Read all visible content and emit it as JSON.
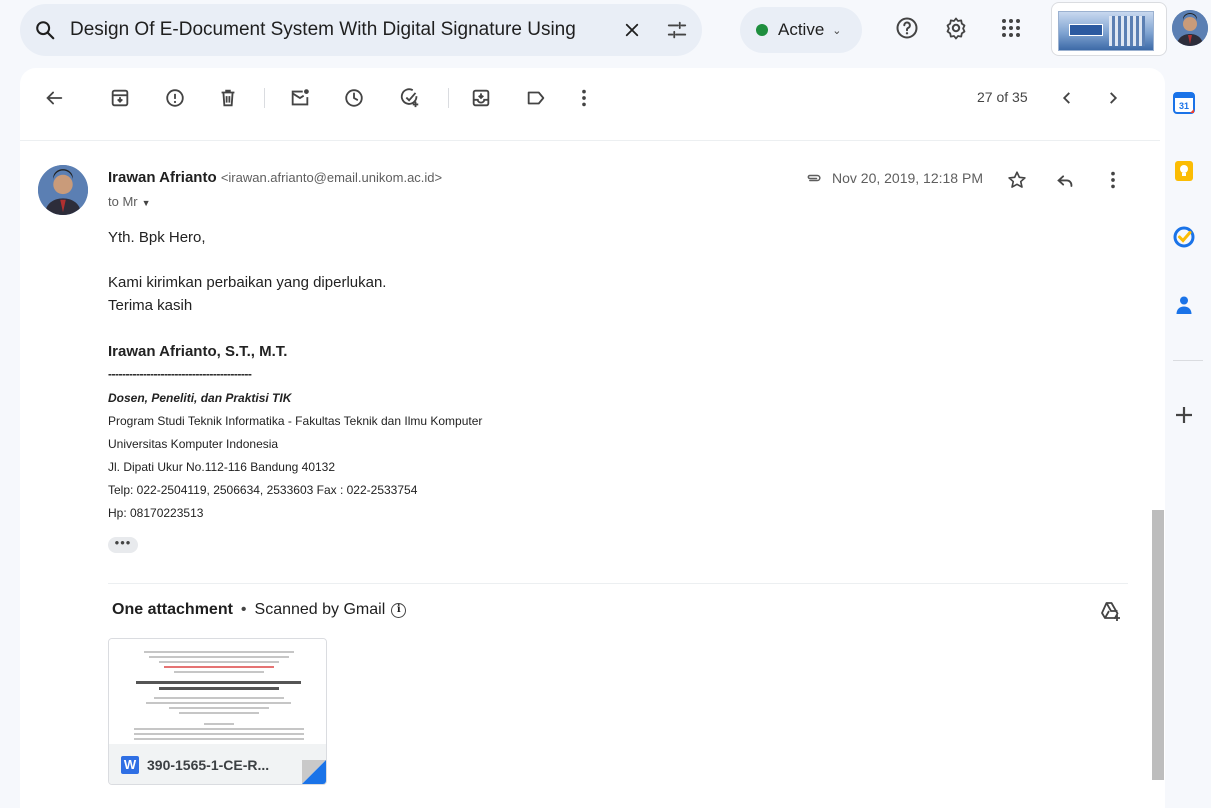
{
  "search": {
    "query": "Design Of E-Document System With Digital Signature Using"
  },
  "status": {
    "label": "Active",
    "color": "#1e8e3e"
  },
  "pagination": {
    "text": "27 of 35"
  },
  "message": {
    "sender_name": "Irawan Afrianto",
    "sender_email": "<irawan.afrianto@email.unikom.ac.id>",
    "recipient": "to Mr",
    "date": "Nov 20, 2019, 12:18 PM",
    "greeting": "Yth. Bpk Hero,",
    "body_line1": "Kami kirimkan perbaikan yang diperlukan.",
    "body_line2": "Terima kasih",
    "signature": {
      "name": "Irawan Afrianto, S.T., M.T.",
      "rule": "-----------------------------------------",
      "role": "Dosen, Peneliti, dan Praktisi TIK",
      "program": "Program Studi Teknik Informatika - Fakultas Teknik dan Ilmu Komputer",
      "university": "Universitas Komputer Indonesia",
      "address": "Jl. Dipati Ukur No.112-116 Bandung 40132",
      "phone": "Telp: 022-2504119, 2506634, 2533603 Fax : 022-2533754",
      "mobile": "Hp: 08170223513"
    },
    "ellipsis": "•••"
  },
  "attachments": {
    "heading": "One attachment",
    "scanned": "Scanned by Gmail",
    "file": {
      "type_badge": "W",
      "name": "390-1565-1-CE-R..."
    }
  }
}
